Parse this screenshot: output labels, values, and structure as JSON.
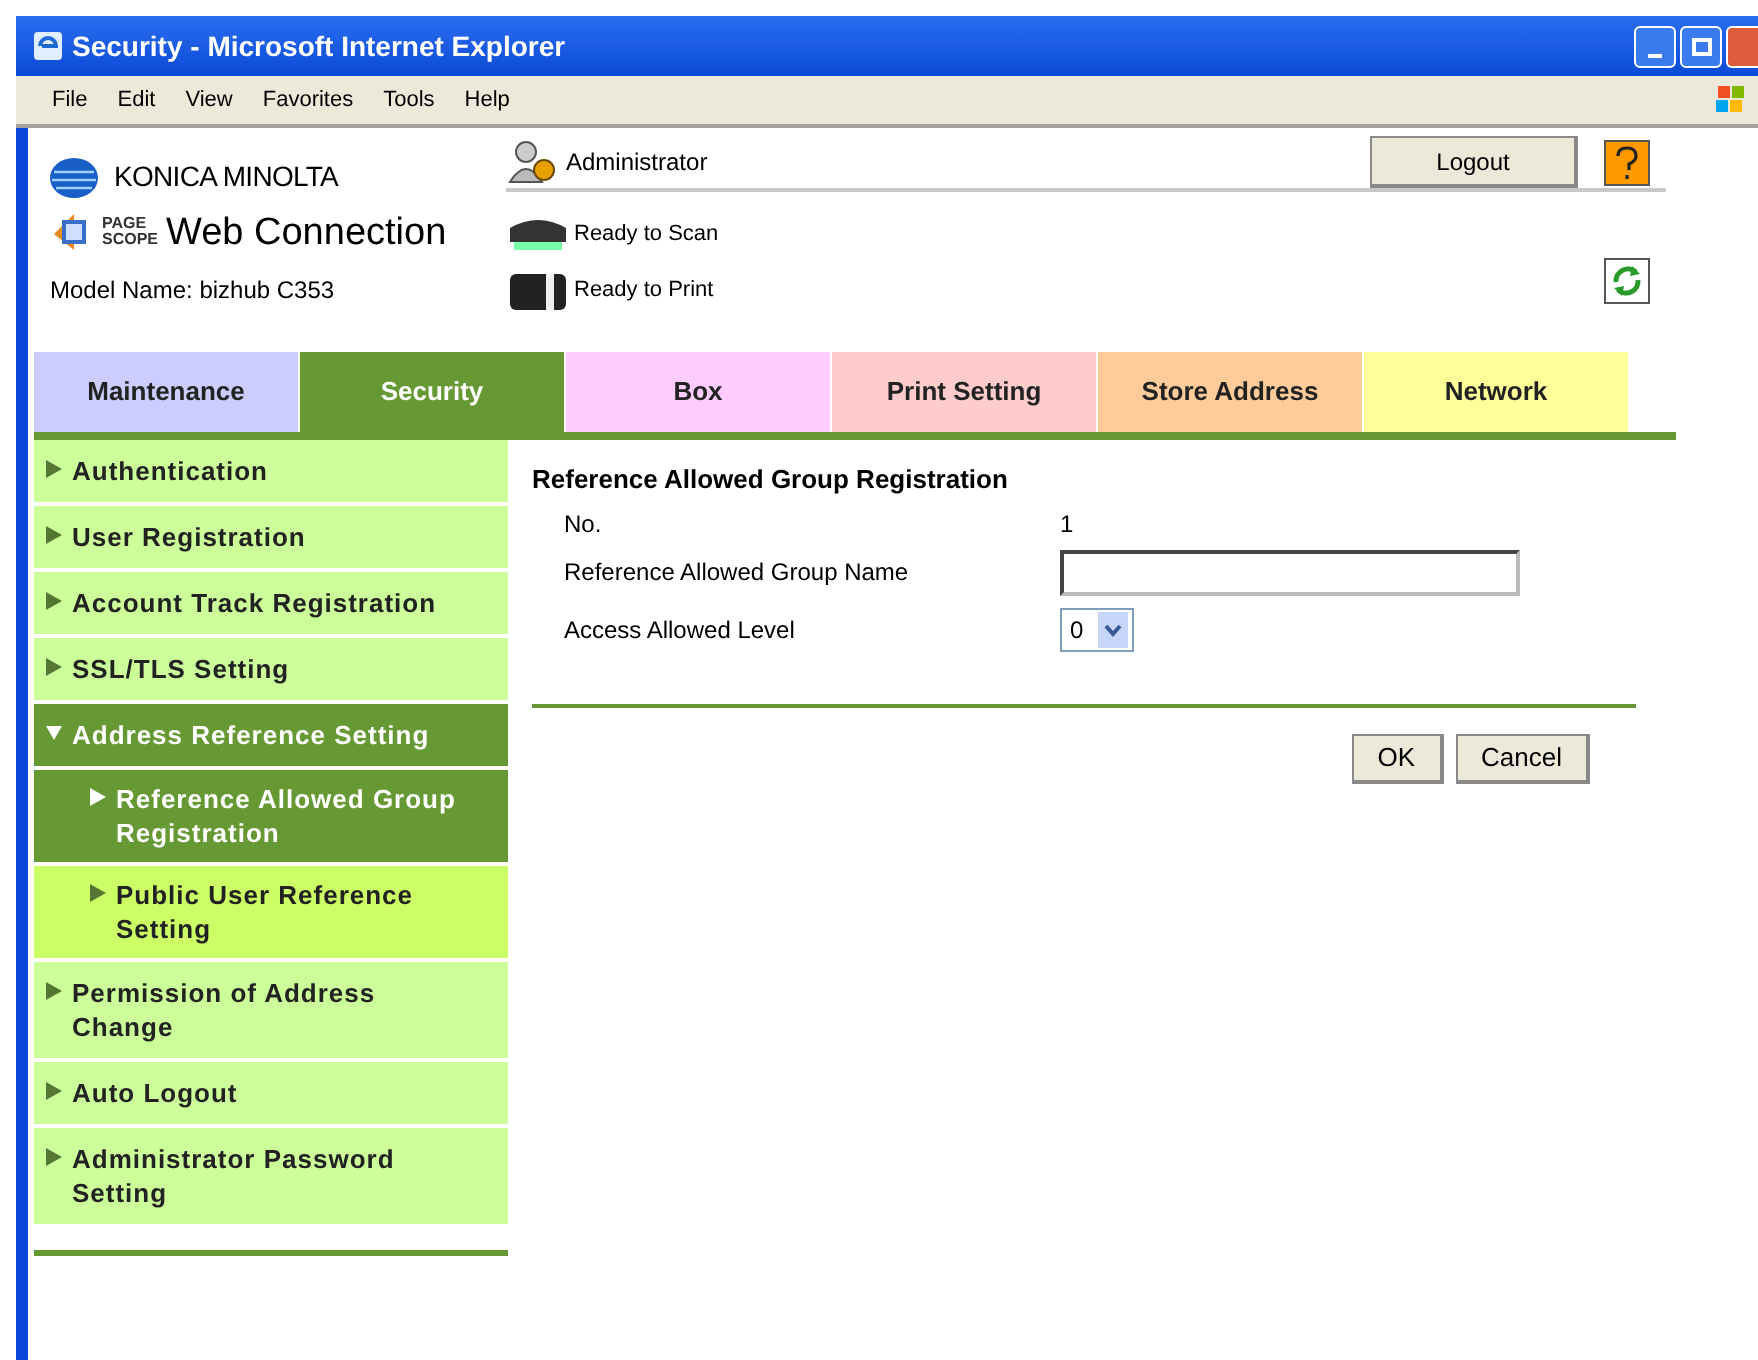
{
  "window": {
    "title": "Security - Microsoft Internet Explorer"
  },
  "menu": [
    "File",
    "Edit",
    "View",
    "Favorites",
    "Tools",
    "Help"
  ],
  "header": {
    "brand": "KONICA MINOLTA",
    "logo_small": [
      "PAGE",
      "SCOPE"
    ],
    "product": "Web Connection",
    "model": "Model Name: bizhub C353",
    "user": "Administrator",
    "logout": "Logout",
    "status": [
      "Ready to Scan",
      "Ready to Print"
    ]
  },
  "tabs": [
    {
      "label": "Maintenance",
      "selected": false,
      "color": "#ccccff"
    },
    {
      "label": "Security",
      "selected": true,
      "color": "#669933"
    },
    {
      "label": "Box",
      "selected": false,
      "color": "#ffccff"
    },
    {
      "label": "Print Setting",
      "selected": false,
      "color": "#ffcccc"
    },
    {
      "label": "Store Address",
      "selected": false,
      "color": "#ffcc99"
    },
    {
      "label": "Network",
      "selected": false,
      "color": "#ffff99"
    }
  ],
  "sidebar": {
    "items": [
      {
        "label": "Authentication",
        "selected": false,
        "expanded": false
      },
      {
        "label": "User Registration",
        "selected": false,
        "expanded": false
      },
      {
        "label": "Account Track Registration",
        "selected": false,
        "expanded": false
      },
      {
        "label": "SSL/TLS Setting",
        "selected": false,
        "expanded": false
      },
      {
        "label": "Address Reference Setting",
        "selected": true,
        "expanded": true,
        "children": [
          {
            "label": "Reference Allowed Group Registration",
            "selected": true
          },
          {
            "label": "Public User Reference Setting",
            "selected": false
          }
        ]
      },
      {
        "label": "Permission of Address Change",
        "selected": false,
        "expanded": false
      },
      {
        "label": "Auto Logout",
        "selected": false,
        "expanded": false
      },
      {
        "label": "Administrator Password Setting",
        "selected": false,
        "expanded": false
      }
    ]
  },
  "form": {
    "title": "Reference Allowed Group Registration",
    "fields": [
      {
        "kind": "text",
        "label": "No.",
        "value": "1"
      },
      {
        "kind": "input",
        "label": "Reference Allowed Group Name"
      },
      {
        "kind": "select",
        "label": "Access Allowed Level",
        "value": "0"
      }
    ],
    "buttons": [
      "OK",
      "Cancel"
    ]
  }
}
